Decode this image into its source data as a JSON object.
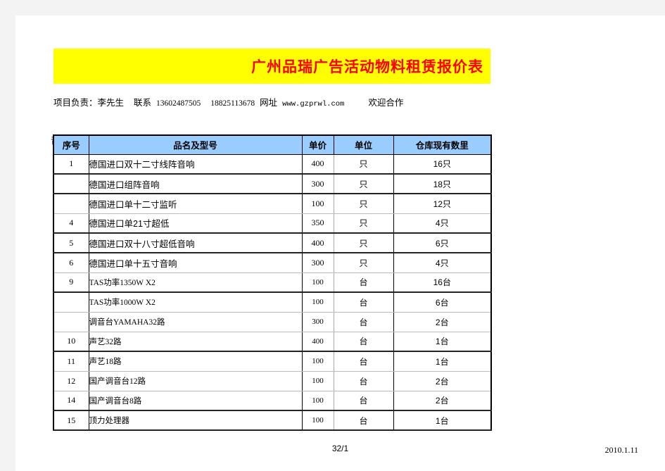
{
  "banner": {
    "title": "广州品瑞广告活动物料租赁报价表",
    "background_color": "#ffff00",
    "title_color": "#ff0000"
  },
  "contact": {
    "owner_label": "项目负责：",
    "owner_name": "李先生",
    "contact_label": "联系",
    "phone1": "13602487505",
    "phone2": "18825113678",
    "website_label": "网址",
    "website": "www.gzprwl.com",
    "welcome": "欢迎合作"
  },
  "section": {
    "label": "音响部分"
  },
  "table": {
    "header_background": "#99ccff",
    "columns": [
      "序号",
      "品名及型号",
      "单价",
      "单位",
      "仓库现有数里"
    ],
    "rows": [
      {
        "no": "1",
        "name": "德国进口双十二寸线阵音响",
        "price": "400",
        "unit": "只",
        "stock": "16只",
        "font": "sans",
        "rule": "hb"
      },
      {
        "no": "",
        "name": "德国进口组阵音响",
        "price": "300",
        "unit": "只",
        "stock": "18只",
        "font": "sans",
        "rule": "hb"
      },
      {
        "no": "",
        "name": "德国进口单十二寸监听",
        "price": "100",
        "unit": "只",
        "stock": "12只",
        "font": "sans",
        "rule": "hl"
      },
      {
        "no": "4",
        "name": "德国进口单21寸超低",
        "price": "350",
        "unit": "只",
        "stock": "4只",
        "font": "sans",
        "rule": "hb"
      },
      {
        "no": "5",
        "name": "德国进口双十八寸超低音响",
        "price": "400",
        "unit": "只",
        "stock": "6只",
        "font": "sans",
        "rule": "hb"
      },
      {
        "no": "6",
        "name": "德国进口单十五寸音响",
        "price": "300",
        "unit": "只",
        "stock": "4只",
        "font": "sans",
        "rule": "hl"
      },
      {
        "no": "9",
        "name": "TAS功率1350W X2",
        "price": "100",
        "unit": "台",
        "stock": "16台",
        "font": "serif",
        "rule": "hb"
      },
      {
        "no": "",
        "name": "TAS功率1000W X2",
        "price": "100",
        "unit": "台",
        "stock": "6台",
        "font": "serif",
        "rule": "hl"
      },
      {
        "no": "",
        "name": "调音台YAMAHA32路",
        "price": "300",
        "unit": "台",
        "stock": "2台",
        "font": "serif",
        "rule": "hl"
      },
      {
        "no": "10",
        "name": "声艺32路",
        "price": "400",
        "unit": "台",
        "stock": "1台",
        "font": "serif",
        "rule": "hb"
      },
      {
        "no": "11",
        "name": "声艺18路",
        "price": "100",
        "unit": "台",
        "stock": "1台",
        "font": "serif",
        "rule": "hl"
      },
      {
        "no": "12",
        "name": "国产调音台12路",
        "price": "100",
        "unit": "台",
        "stock": "2台",
        "font": "serif",
        "rule": "hl"
      },
      {
        "no": "14",
        "name": "国产调音台8路",
        "price": "100",
        "unit": "台",
        "stock": "2台",
        "font": "serif",
        "rule": "hb"
      },
      {
        "no": "15",
        "name": "顶力处理器",
        "price": "100",
        "unit": "台",
        "stock": "1台",
        "font": "serif",
        "rule": "hb"
      }
    ]
  },
  "footer": {
    "page_indicator": "32/1",
    "date": "2010.1.11"
  }
}
